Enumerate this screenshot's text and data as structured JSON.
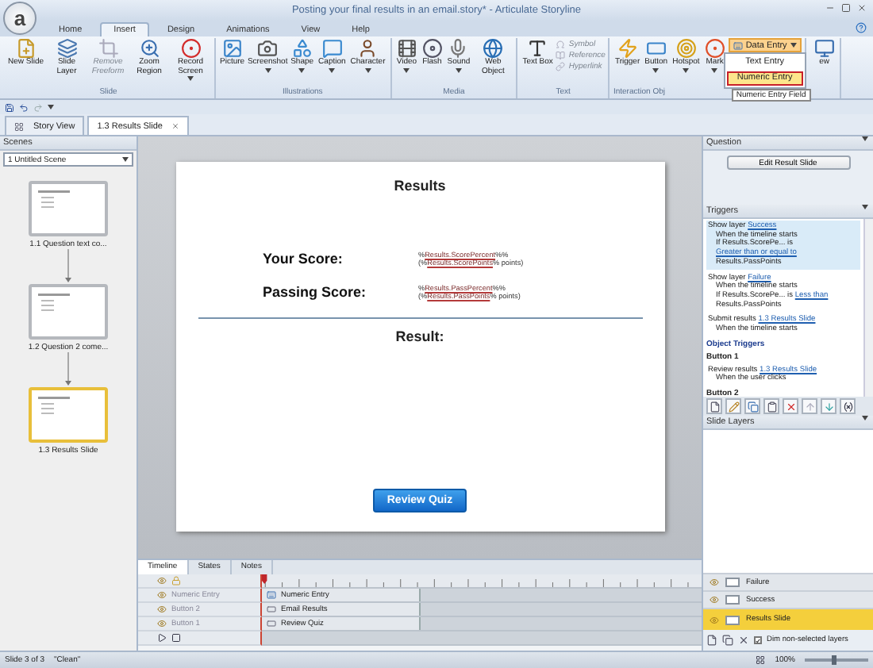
{
  "window": {
    "title": "Posting your final results in an email.story* - Articulate Storyline",
    "logo": "a"
  },
  "ribbon_tabs": [
    {
      "label": "Home",
      "selected": false
    },
    {
      "label": "Insert",
      "selected": true
    },
    {
      "label": "Design",
      "selected": false
    },
    {
      "label": "Animations",
      "selected": false
    },
    {
      "label": "View",
      "selected": false
    },
    {
      "label": "Help",
      "selected": false
    }
  ],
  "ribbon_groups": [
    {
      "label": "Slide",
      "items": [
        {
          "kind": "large",
          "label": "New Slide",
          "disabled": false,
          "menu": false
        },
        {
          "kind": "large",
          "label": "Slide Layer",
          "disabled": false,
          "menu": false
        },
        {
          "kind": "large",
          "label": "Remove Freeform",
          "disabled": true,
          "menu": false
        },
        {
          "kind": "large",
          "label": "Zoom Region",
          "disabled": false,
          "menu": false
        },
        {
          "kind": "large",
          "label": "Record Screen",
          "disabled": false,
          "menu": true
        }
      ]
    },
    {
      "label": "Illustrations",
      "items": [
        {
          "kind": "large",
          "label": "Picture",
          "disabled": false,
          "menu": false
        },
        {
          "kind": "large",
          "label": "Screenshot",
          "disabled": false,
          "menu": true
        },
        {
          "kind": "large",
          "label": "Shape",
          "disabled": false,
          "menu": true
        },
        {
          "kind": "large",
          "label": "Caption",
          "disabled": false,
          "menu": true
        },
        {
          "kind": "large",
          "label": "Character",
          "disabled": false,
          "menu": true
        }
      ]
    },
    {
      "label": "Media",
      "items": [
        {
          "kind": "large",
          "label": "Video",
          "disabled": false,
          "menu": true
        },
        {
          "kind": "large",
          "label": "Flash",
          "disabled": false,
          "menu": false
        },
        {
          "kind": "large",
          "label": "Sound",
          "disabled": false,
          "menu": true
        },
        {
          "kind": "large",
          "label": "Web Object",
          "disabled": false,
          "menu": false
        }
      ]
    },
    {
      "label": "Text",
      "items": [
        {
          "kind": "large",
          "label": "Text Box",
          "disabled": false,
          "menu": false
        },
        {
          "kind": "small",
          "label": "Symbol",
          "disabled": true,
          "menu": false
        },
        {
          "kind": "small",
          "label": "Reference",
          "disabled": true,
          "menu": false
        },
        {
          "kind": "small",
          "label": "Hyperlink",
          "disabled": true,
          "menu": false
        }
      ]
    },
    {
      "label": "Interaction Obj",
      "items": [
        {
          "kind": "large",
          "label": "Trigger",
          "disabled": false,
          "menu": false
        },
        {
          "kind": "large",
          "label": "Button",
          "disabled": false,
          "menu": true
        },
        {
          "kind": "large",
          "label": "Hotspot",
          "disabled": false,
          "menu": true
        },
        {
          "kind": "large",
          "label": "Mark",
          "disabled": false,
          "menu": true
        },
        {
          "kind": "dropdown",
          "label": "Data Entry",
          "disabled": false,
          "menu": true,
          "expanded": true
        }
      ]
    }
  ],
  "preview_button": {
    "label": "ew"
  },
  "data_entry_menu": {
    "items": [
      {
        "label": "Text Entry",
        "selected": false
      },
      {
        "label": "Numeric Entry",
        "selected": true
      }
    ],
    "tooltip": "Numeric Entry Field"
  },
  "doc_tabs": [
    {
      "label": "Story View",
      "selected": false,
      "closable": false
    },
    {
      "label": "1.3 Results Slide",
      "selected": true,
      "closable": true
    }
  ],
  "scenes": {
    "title": "Scenes",
    "scene_select": "1 Untitled Scene",
    "slides": [
      {
        "label": "1.1 Question text co...",
        "selected": false
      },
      {
        "label": "1.2 Question 2 come...",
        "selected": false
      },
      {
        "label": "1.3 Results Slide",
        "selected": true
      }
    ]
  },
  "slide": {
    "title": "Results",
    "rows": [
      {
        "label": "Your Score:",
        "value": [
          {
            "text": "%",
            "var": false
          },
          {
            "text": "Results.ScorePercent",
            "var": true
          },
          {
            "text": "%% (%",
            "var": false
          },
          {
            "text": "Results.ScorePoints",
            "var": true
          },
          {
            "text": "% points)",
            "var": false
          }
        ]
      },
      {
        "label": "Passing Score:",
        "value": [
          {
            "text": "%",
            "var": false
          },
          {
            "text": "Results.PassPercent",
            "var": true
          },
          {
            "text": "%% (%",
            "var": false
          },
          {
            "text": "Results.PassPoints",
            "var": true
          },
          {
            "text": "% points)",
            "var": false
          }
        ]
      }
    ],
    "result_label": "Result:",
    "button": "Review Quiz"
  },
  "timeline": {
    "tabs": [
      {
        "label": "Timeline",
        "selected": true
      },
      {
        "label": "States",
        "selected": false
      },
      {
        "label": "Notes",
        "selected": false
      }
    ],
    "rows": [
      {
        "name": "Numeric Entry",
        "bar": "Numeric Entry",
        "kind": "entry"
      },
      {
        "name": "Button 2",
        "bar": "Email Results",
        "kind": "button"
      },
      {
        "name": "Button 1",
        "bar": "Review Quiz",
        "kind": "button"
      }
    ]
  },
  "question": {
    "title": "Question",
    "button": "Edit Result Slide"
  },
  "triggers": {
    "title": "Triggers",
    "items": [
      {
        "selected": true,
        "action": "Show layer",
        "target": "Success",
        "when": "When the timeline starts",
        "condition": {
          "subject": "If Results.ScorePe... is",
          "operator": "Greater than or equal to",
          "value": "Results.PassPoints"
        }
      },
      {
        "selected": false,
        "action": "Show layer",
        "target": "Failure",
        "when": "When the timeline starts",
        "condition": {
          "subject": "If Results.ScorePe... is",
          "operator": "Less than",
          "value": "Results.PassPoints"
        }
      },
      {
        "selected": false,
        "action": "Submit results",
        "target": "1.3 Results Slide",
        "when": "When the timeline starts"
      }
    ],
    "object_triggers_title": "Object Triggers",
    "objects": [
      {
        "name": "Button 1",
        "items": [
          {
            "selected": false,
            "action": "Review results",
            "target": "1.3 Results Slide",
            "when": "When the user clicks"
          }
        ]
      },
      {
        "name": "Button 2"
      }
    ]
  },
  "slide_layers": {
    "title": "Slide Layers",
    "layers": [
      {
        "name": "Failure",
        "selected": false
      },
      {
        "name": "Success",
        "selected": false
      },
      {
        "name": "Results Slide",
        "selected": true
      }
    ],
    "dim_label": "Dim non-selected layers",
    "dim_checked": true
  },
  "status_bar": {
    "slide": "Slide 3 of 3",
    "theme": "\"Clean\"",
    "zoom": "100%",
    "zoom_slider": {
      "level": 0.45
    }
  }
}
